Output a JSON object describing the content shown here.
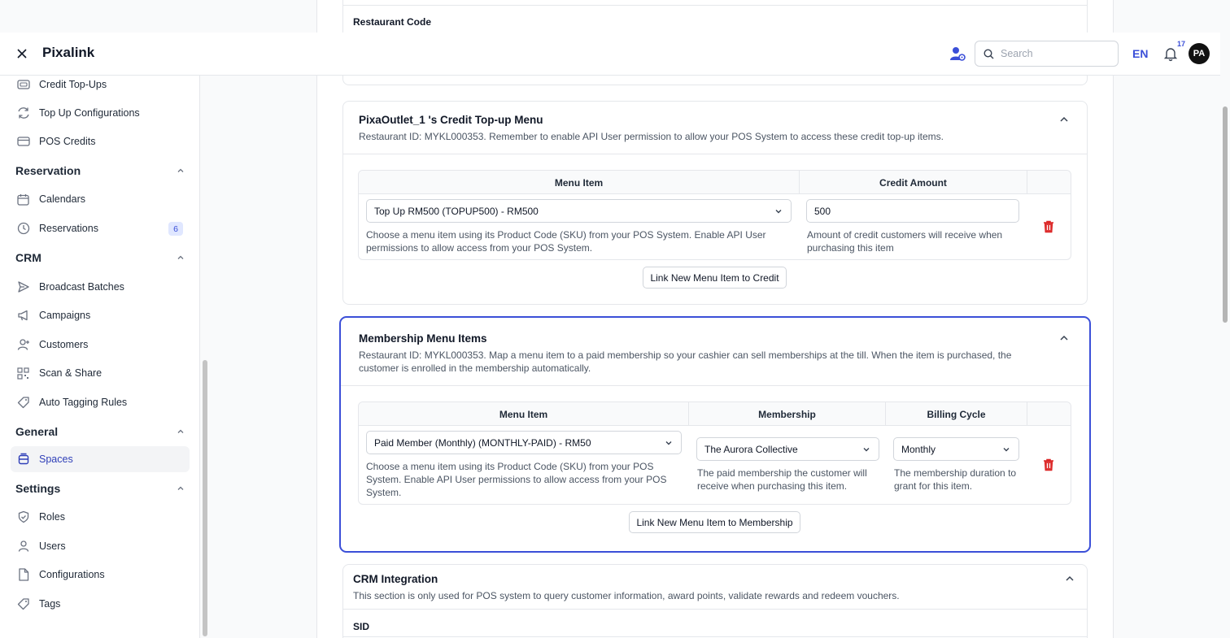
{
  "header": {
    "brand": "Pixalink",
    "search_placeholder": "Search",
    "language": "EN",
    "notification_count": "17",
    "avatar_initials": "PA"
  },
  "sidebar": {
    "items_top": [
      {
        "label": "Credit Top-Ups",
        "icon": "wallet-icon"
      },
      {
        "label": "Top Up Configurations",
        "icon": "refresh-icon"
      },
      {
        "label": "POS Credits",
        "icon": "card-icon"
      }
    ],
    "sections": [
      {
        "title": "Reservation",
        "items": [
          {
            "label": "Calendars",
            "icon": "calendar-icon"
          },
          {
            "label": "Reservations",
            "icon": "clock-icon",
            "badge": "6"
          }
        ]
      },
      {
        "title": "CRM",
        "items": [
          {
            "label": "Broadcast Batches",
            "icon": "send-icon"
          },
          {
            "label": "Campaigns",
            "icon": "megaphone-icon"
          },
          {
            "label": "Customers",
            "icon": "user-plus-icon"
          },
          {
            "label": "Scan & Share",
            "icon": "qr-icon"
          },
          {
            "label": "Auto Tagging Rules",
            "icon": "tag-icon"
          }
        ]
      },
      {
        "title": "General",
        "items": [
          {
            "label": "Spaces",
            "icon": "layers-icon",
            "active": true
          }
        ]
      },
      {
        "title": "Settings",
        "items": [
          {
            "label": "Roles",
            "icon": "shield-icon"
          },
          {
            "label": "Users",
            "icon": "user-icon"
          },
          {
            "label": "Configurations",
            "icon": "file-icon"
          },
          {
            "label": "Tags",
            "icon": "tag-icon"
          }
        ]
      }
    ]
  },
  "main": {
    "restaurant_code_label": "Restaurant Code",
    "credit_card": {
      "title": "PixaOutlet_1 's Credit Top-up Menu",
      "description": "Restaurant ID: MYKL000353. Remember to enable API User permission to allow your POS System to access these credit top-up items.",
      "columns": [
        "Menu Item",
        "Credit Amount"
      ],
      "row": {
        "menu_item": "Top Up RM500 (TOPUP500) - RM500",
        "menu_item_help": "Choose a menu item using its Product Code (SKU) from your POS System. Enable API User permissions to allow access from your POS System.",
        "credit_amount": "500",
        "credit_amount_help": "Amount of credit customers will receive when purchasing this item"
      },
      "link_button": "Link New Menu Item to Credit"
    },
    "membership_card": {
      "title": "Membership Menu Items",
      "description": "Restaurant ID: MYKL000353. Map a menu item to a paid membership so your cashier can sell memberships at the till. When the item is purchased, the customer is enrolled in the membership automatically.",
      "columns": [
        "Menu Item",
        "Membership",
        "Billing Cycle"
      ],
      "row": {
        "menu_item": "Paid Member (Monthly) (MONTHLY-PAID) - RM50",
        "menu_item_help": "Choose a menu item using its Product Code (SKU) from your POS System. Enable API User permissions to allow access from your POS System.",
        "membership": "The Aurora Collective",
        "membership_help": "The paid membership the customer will receive when purchasing this item.",
        "billing_cycle": "Monthly",
        "billing_cycle_help": "The membership duration to grant for this item."
      },
      "link_button": "Link New Menu Item to Membership"
    },
    "crm_card": {
      "title": "CRM Integration",
      "description": "This section is only used for POS system to query customer information, award points, validate rewards and redeem vouchers.",
      "sid_label": "SID"
    }
  },
  "colors": {
    "accent": "#3b4fd8",
    "danger": "#dc2626",
    "highlight_border": "#3b4fd8"
  }
}
